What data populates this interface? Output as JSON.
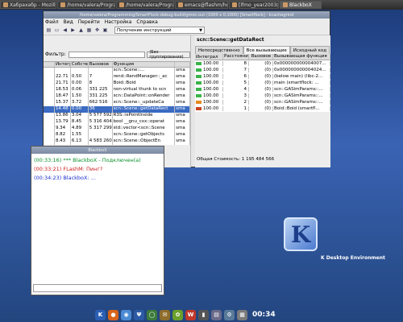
{
  "taskbar": {
    "tasks": [
      {
        "label": "Хабрахабр - Mozilla Fir",
        "icon": "firefox-icon"
      },
      {
        "label": "/home/valera/Program",
        "icon": "folder-icon"
      },
      {
        "label": "/home/valera/Program",
        "icon": "folder-icon"
      },
      {
        "label": "emacs@flashm/home",
        "icon": "emacs-icon"
      },
      {
        "label": "[lfmo_year2003@conf",
        "icon": "terminal-icon"
      },
      {
        "label": "BlackboX",
        "icon": "blackbox-icon",
        "active": true
      }
    ]
  },
  "main_window": {
    "title": "/home/valera/Programming/SmartFlock-debug-build/gmon.out (1000 x 0,1000) [Smartflock] - kcachegrind",
    "menu": [
      "Файл",
      "Вид",
      "Перейти",
      "Настройка",
      "Справка"
    ],
    "combo": "Получение инструкций",
    "filter_label": "Фильтр:",
    "group_button": "(Без группирования)",
    "columns": [
      "",
      "Интегра",
      "Собств",
      "Вызовов",
      "Функция",
      ""
    ],
    "rows": [
      {
        "c1": "",
        "c2": "",
        "c3": "",
        "c4": "",
        "c5": "scn::Scene::...",
        "c6": "sma",
        "sel": false
      },
      {
        "c1": "",
        "c2": "22.71",
        "c3": "0.50",
        "c4": "7",
        "c5": "rend::RendManager::_ac",
        "c6": "sma",
        "sel": false
      },
      {
        "c1": "",
        "c2": "21.71",
        "c3": "0.00",
        "c4": "8",
        "c5": "Boid::Boid",
        "c6": "sma",
        "sel": false
      },
      {
        "c1": "",
        "c2": "18.53",
        "c3": "0.06",
        "c4": "331 225",
        "c5": "non-virtual thunk to scn",
        "c6": "sma",
        "sel": false
      },
      {
        "c1": "",
        "c2": "18.47",
        "c3": "1.50",
        "c4": "331 225",
        "c5": "scn::DataPoint::onRender",
        "c6": "sma",
        "sel": false
      },
      {
        "c1": "",
        "c2": "15.37",
        "c3": "3.72",
        "c4": "662 516",
        "c5": "scn::Scene::_updateCa",
        "c6": "sma",
        "sel": false
      },
      {
        "c1": "",
        "c2": "14.48",
        "c3": "0.00",
        "c4": "36",
        "c5": "scn::Scene::getDataRect",
        "c6": "sma",
        "sel": true
      },
      {
        "c1": "",
        "c2": "13.86",
        "c3": "3.04",
        "c4": "5 577 592",
        "c5": "R3S::isPointInside",
        "c6": "sma",
        "sel": false
      },
      {
        "c1": "",
        "c2": "13.79",
        "c3": "8.45",
        "c4": "5 316 404",
        "c5": "bool __gnu_cxx::operat",
        "c6": "sma",
        "sel": false
      },
      {
        "c1": "",
        "c2": "9.34",
        "c3": "4.89",
        "c4": "5 317 299",
        "c5": "std::vector<scn::Scene",
        "c6": "sma",
        "sel": false
      },
      {
        "c1": "",
        "c2": "8.82",
        "c3": "1.55",
        "c4": "",
        "c5": "scn::Scene::getObjects",
        "c6": "sma",
        "sel": false
      },
      {
        "c1": "",
        "c2": "8.43",
        "c3": "6.13",
        "c4": "4 583 260",
        "c5": "scn::Scene::ObjectEn",
        "c6": "sma",
        "sel": false
      }
    ],
    "detail_title": "scn::Scene::getDataRect",
    "tabs": [
      "Непосредственно",
      "Все вызывающие",
      "Исходный код"
    ],
    "detail_columns": [
      "Интеграл",
      "Расстояние",
      "Вызовов",
      "Вызывающая функция"
    ],
    "detail_rows": [
      {
        "val": "100.00",
        "dist": "8",
        "calls": "(0)",
        "fn": "0x000000000004007...",
        "color": "#3cb34a"
      },
      {
        "val": "100.00",
        "dist": "7",
        "calls": "(0)",
        "fn": "0x000000000004024...",
        "color": "#3cb34a"
      },
      {
        "val": "100.00",
        "dist": "6",
        "calls": "(0)",
        "fn": "(below main) (libc-2...",
        "color": "#3cb34a"
      },
      {
        "val": "100.00",
        "dist": "5",
        "calls": "(0)",
        "fn": "main (smartflock: ...",
        "color": "#3cb34a"
      },
      {
        "val": "100.00",
        "dist": "4",
        "calls": "(0)",
        "fn": "scn::GASimParams::...",
        "color": "#3cb34a"
      },
      {
        "val": "100.00",
        "dist": "3",
        "calls": "(0)",
        "fn": "scn::GASimParams::...",
        "color": "#3cb34a"
      },
      {
        "val": "100.00",
        "dist": "2",
        "calls": "(0)",
        "fn": "scn::GASimParams::...",
        "color": "#e48a1f"
      },
      {
        "val": "100.00",
        "dist": "1",
        "calls": "(0)",
        "fn": "Boid::Boid (smartfl...",
        "color": "#c9431f"
      }
    ],
    "status": "Общая Стоимость: 1 195 484 566"
  },
  "blackbox": {
    "title": "BlackboX",
    "messages": [
      {
        "text": "(00:33:16) *** BlackboX - Подключен(а)",
        "color": "#0a8f2a"
      },
      {
        "text": "(00:33:21) FLashM: Пинг?",
        "color": "#cc1a1a"
      },
      {
        "text": "(00:34:23) BlackboX: ...",
        "color": "#1a2fcc"
      }
    ]
  },
  "kde": {
    "logo_letter": "K",
    "text": "K Desktop Environment"
  },
  "dock": {
    "icons": [
      {
        "name": "kmenu-icon",
        "glyph": "K",
        "color": "#2b5fb4"
      },
      {
        "name": "firefox-icon",
        "glyph": "●",
        "color": "#d8641b"
      },
      {
        "name": "browser-icon",
        "glyph": "◉",
        "color": "#4a8ad4"
      },
      {
        "name": "fork-icon",
        "glyph": "Ψ",
        "color": "#2c5aa5"
      },
      {
        "name": "search-icon",
        "glyph": "◯",
        "color": "#3b7a3b"
      },
      {
        "name": "mail-icon",
        "glyph": "✉",
        "color": "#8e6d2b"
      },
      {
        "name": "chat-icon",
        "glyph": "✿",
        "color": "#6aa02b"
      },
      {
        "name": "docs-icon",
        "glyph": "W",
        "color": "#c0392b"
      },
      {
        "name": "terminal-icon",
        "glyph": "▮",
        "color": "#555"
      },
      {
        "name": "files-icon",
        "glyph": "▤",
        "color": "#6a6a8a"
      },
      {
        "name": "settings-icon",
        "glyph": "⚙",
        "color": "#5a7a9a"
      },
      {
        "name": "workspace-icon",
        "glyph": "▦",
        "color": "#7a7a7a"
      }
    ],
    "clock": "00:34"
  }
}
